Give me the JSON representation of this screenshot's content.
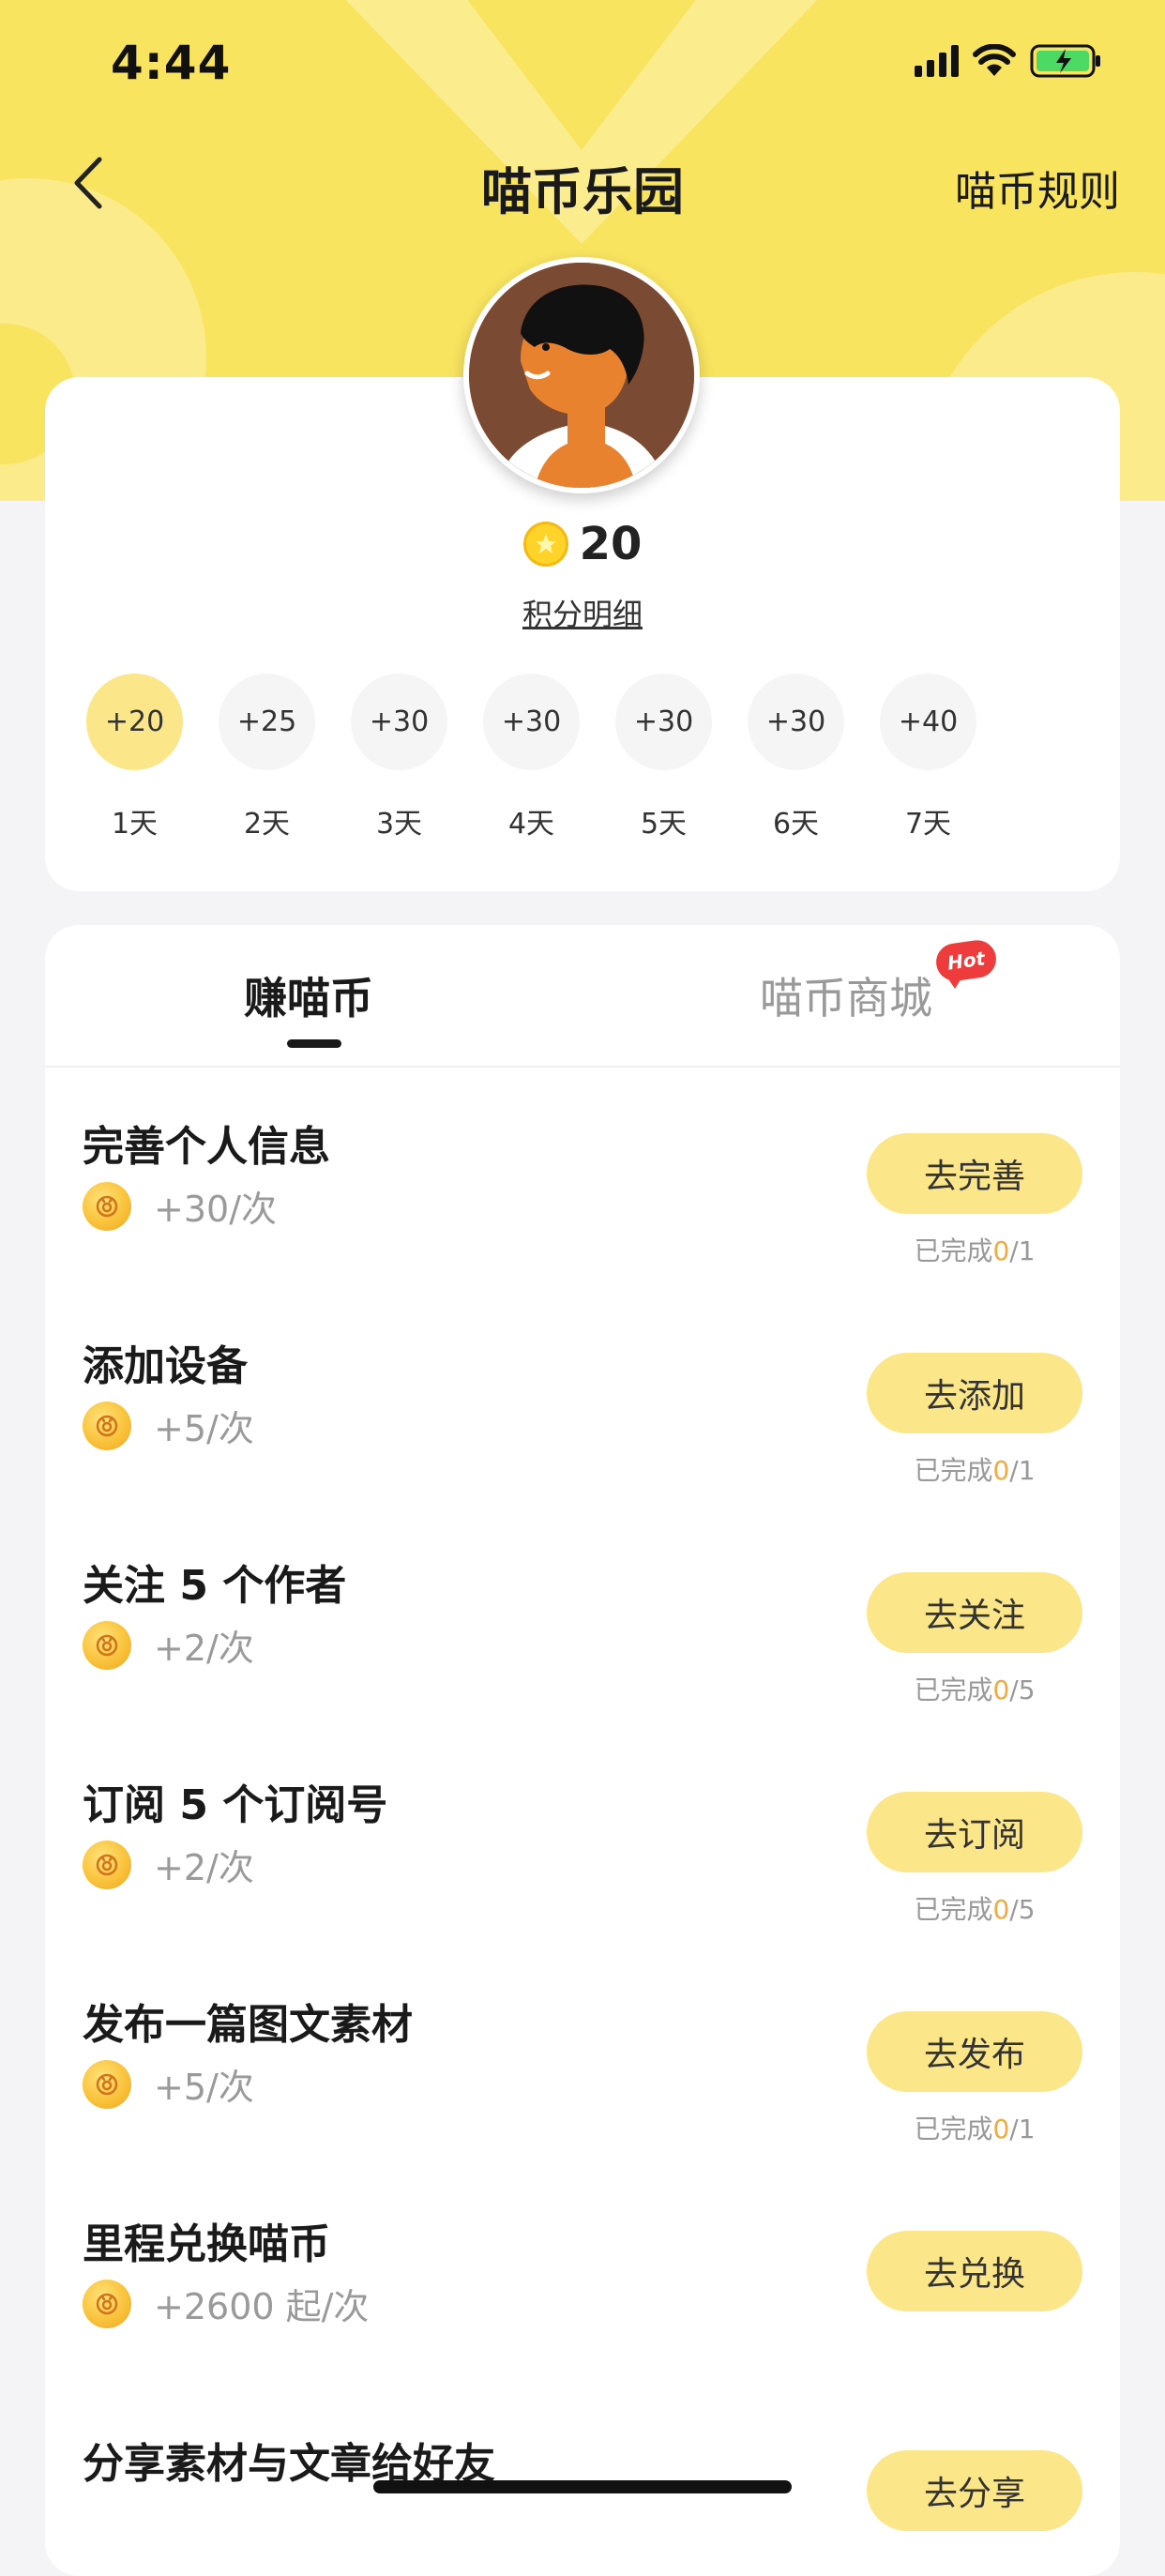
{
  "status_bar": {
    "time": "4:44"
  },
  "nav": {
    "title": "喵币乐园",
    "rules_label": "喵币规则"
  },
  "profile": {
    "coins": "20",
    "detail_link": "积分明细"
  },
  "checkin": [
    {
      "reward": "+20",
      "day": "1天",
      "active": true
    },
    {
      "reward": "+25",
      "day": "2天",
      "active": false
    },
    {
      "reward": "+30",
      "day": "3天",
      "active": false
    },
    {
      "reward": "+30",
      "day": "4天",
      "active": false
    },
    {
      "reward": "+30",
      "day": "5天",
      "active": false
    },
    {
      "reward": "+30",
      "day": "6天",
      "active": false
    },
    {
      "reward": "+40",
      "day": "7天",
      "active": false
    }
  ],
  "tabs": {
    "earn": "赚喵币",
    "shop": "喵币商城",
    "hot_badge": "Hot"
  },
  "tasks": [
    {
      "title": "完善个人信息",
      "reward": "+30/次",
      "button": "去完善",
      "progress_prefix": "已完成",
      "progress_done": "0",
      "progress_total": "/1"
    },
    {
      "title": "添加设备",
      "reward": "+5/次",
      "button": "去添加",
      "progress_prefix": "已完成",
      "progress_done": "0",
      "progress_total": "/1"
    },
    {
      "title": "关注 5 个作者",
      "reward": "+2/次",
      "button": "去关注",
      "progress_prefix": "已完成",
      "progress_done": "0",
      "progress_total": "/5"
    },
    {
      "title": "订阅 5 个订阅号",
      "reward": "+2/次",
      "button": "去订阅",
      "progress_prefix": "已完成",
      "progress_done": "0",
      "progress_total": "/5"
    },
    {
      "title": "发布一篇图文素材",
      "reward": "+5/次",
      "button": "去发布",
      "progress_prefix": "已完成",
      "progress_done": "0",
      "progress_total": "/1"
    },
    {
      "title": "里程兑换喵币",
      "reward": "+2600 起/次",
      "button": "去兑换"
    },
    {
      "title": "分享素材与文章给好友",
      "button": "去分享"
    }
  ],
  "colors": {
    "header_yellow": "#F9E45F",
    "button_yellow": "#FCE68A",
    "progress_done": "#F3A93B",
    "hot_red": "#EE3B3B"
  }
}
